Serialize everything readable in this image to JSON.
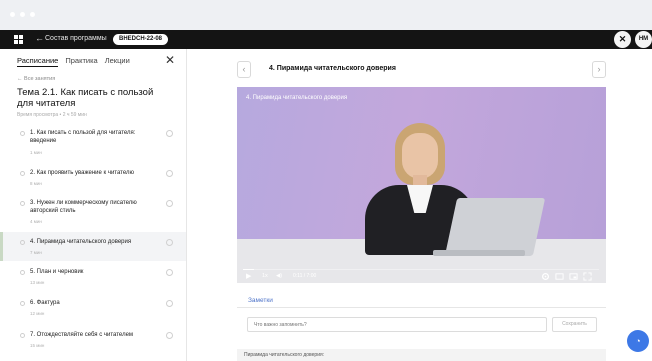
{
  "topbar": {
    "back_arrow": "←",
    "program_link": "Состав программы",
    "program_badge": "BHEDCH-22-08",
    "icon1": "✕",
    "avatar": "HM"
  },
  "sidebar": {
    "tabs": [
      {
        "label": "Расписание",
        "active": true
      },
      {
        "label": "Практика",
        "active": false
      },
      {
        "label": "Лекции",
        "active": false
      }
    ],
    "close": "✕",
    "back_link": "← Все занятия",
    "topic_title": "Тема 2.1. Как писать с пользой для читателя",
    "watch_time": "Время просмотра • 2 ч 59 мин",
    "lessons": [
      {
        "title": "1. Как писать с пользой для читателя: введение",
        "duration": "1 мин",
        "active": false
      },
      {
        "title": "2. Как проявить уважение к читателю",
        "duration": "8 мин",
        "active": false
      },
      {
        "title": "3. Нужен ли коммерческому писателю авторский стиль",
        "duration": "4 мин",
        "active": false
      },
      {
        "title": "4. Пирамида читательского доверия",
        "duration": "7 мин",
        "active": true
      },
      {
        "title": "5. План и черновик",
        "duration": "13 мин",
        "active": false
      },
      {
        "title": "6. Фактура",
        "duration": "12 мин",
        "active": false
      },
      {
        "title": "7. Отождествляйте себя с читателем",
        "duration": "15 мин",
        "active": false
      }
    ]
  },
  "main": {
    "prev": "‹",
    "next": "›",
    "lesson_title": "4. Пирамида читательского доверия",
    "video": {
      "overlay_title": "4. Пирамида читательского доверия",
      "play": "▶",
      "speed": "1x",
      "volume": "◀)",
      "time": "0:11 / 7:00",
      "progress": 0.03,
      "icons": [
        "settings-icon",
        "subtitles-icon",
        "pip-icon",
        "fullscreen-icon"
      ]
    },
    "notes": {
      "tab": "Заметки",
      "placeholder": "Что важно запомнить?",
      "save": "Сохранить",
      "bottom_text": "Пирамида читательского доверия:"
    }
  },
  "chat_fab": "◔"
}
